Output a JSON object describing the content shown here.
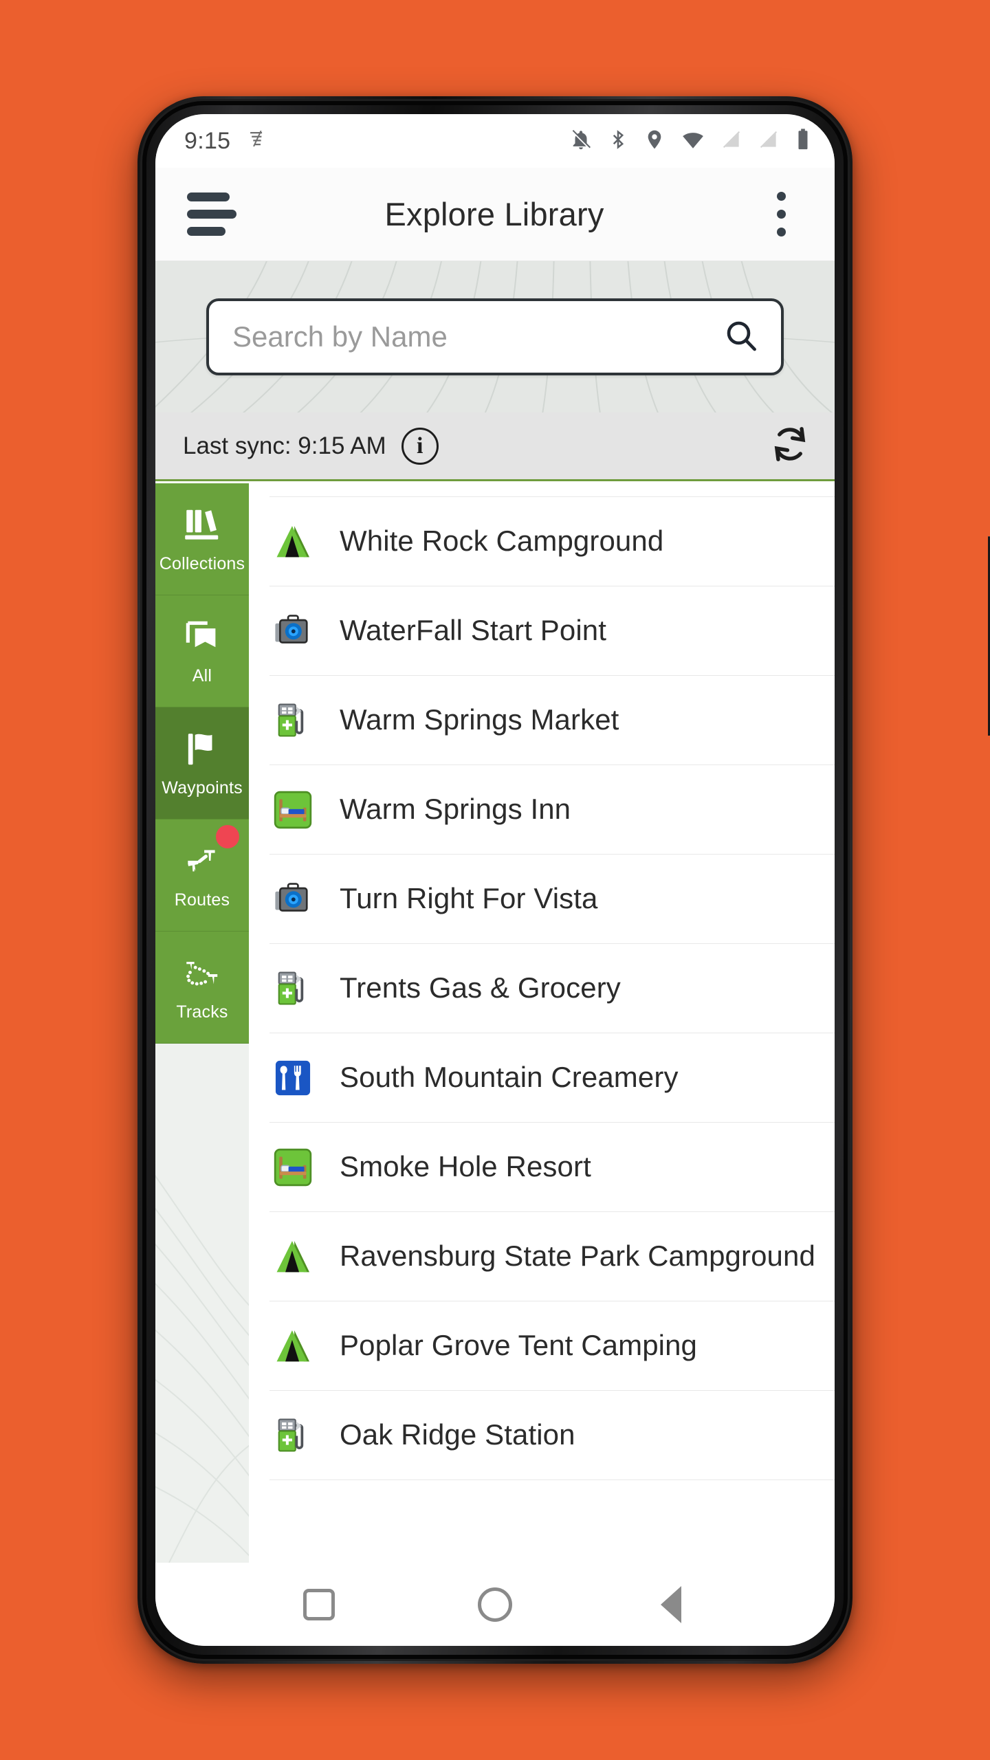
{
  "theme": {
    "background": "#eb5f2e",
    "sidebar_green": "#6aa23c",
    "sidebar_green_selected": "#53802e",
    "badge_red": "#ef4552",
    "header_texture_bg": "#e4e7e4",
    "sync_bar_bg": "#e4e4e4",
    "accent_rule": "#6f9c3d"
  },
  "status_bar": {
    "time": "9:15",
    "left_icons": [
      "wifi-calling-icon"
    ],
    "right_icons": [
      "notifications-off-icon",
      "bluetooth-icon",
      "location-icon",
      "wifi-icon",
      "sim-card-off-1-icon",
      "sim-card-off-2-icon",
      "battery-full-icon"
    ]
  },
  "app_bar": {
    "menu_label": "menu",
    "title": "Explore Library",
    "overflow_label": "more options"
  },
  "search": {
    "placeholder": "Search by Name",
    "value": "",
    "icon": "search-icon"
  },
  "sync": {
    "text": "Last sync: 9:15 AM",
    "info_glyph": "i",
    "refresh_icon": "refresh-icon"
  },
  "sidebar": {
    "items": [
      {
        "label": "Collections",
        "icon": "books-icon",
        "selected": false,
        "badge": false
      },
      {
        "label": "All",
        "icon": "bookmark-stack-icon",
        "selected": false,
        "badge": false
      },
      {
        "label": "Waypoints",
        "icon": "flag-icon",
        "selected": true,
        "badge": false
      },
      {
        "label": "Routes",
        "icon": "route-pins-icon",
        "selected": false,
        "badge": true
      },
      {
        "label": "Tracks",
        "icon": "track-dots-icon",
        "selected": false,
        "badge": false
      }
    ]
  },
  "list": {
    "items": [
      {
        "name": "White Rock Campground",
        "icon": "campground-tent-icon"
      },
      {
        "name": "WaterFall Start Point",
        "icon": "camera-icon"
      },
      {
        "name": "Warm Springs Market",
        "icon": "gas-station-icon"
      },
      {
        "name": "Warm Springs Inn",
        "icon": "lodging-bed-icon"
      },
      {
        "name": "Turn Right For Vista",
        "icon": "camera-icon"
      },
      {
        "name": "Trents Gas & Grocery",
        "icon": "gas-station-icon"
      },
      {
        "name": "South Mountain Creamery",
        "icon": "restaurant-icon"
      },
      {
        "name": "Smoke Hole Resort",
        "icon": "lodging-bed-icon"
      },
      {
        "name": "Ravensburg State Park Campground",
        "icon": "campground-tent-icon"
      },
      {
        "name": "Poplar Grove Tent Camping",
        "icon": "campground-tent-icon"
      },
      {
        "name": "Oak Ridge Station",
        "icon": "gas-station-icon"
      }
    ]
  },
  "nav_bar": {
    "buttons": [
      {
        "label": "recents",
        "icon": "square-icon"
      },
      {
        "label": "home",
        "icon": "circle-icon"
      },
      {
        "label": "back",
        "icon": "triangle-back-icon"
      }
    ]
  }
}
